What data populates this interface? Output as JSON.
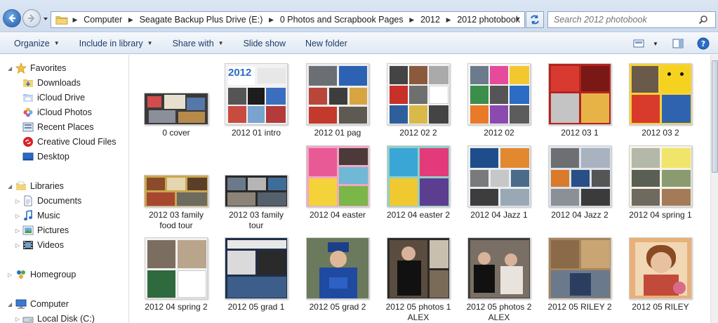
{
  "address": {
    "crumbs": [
      "Computer",
      "Seagate Backup Plus Drive (E:)",
      "0 Photos and Scrapbook Pages",
      "2012",
      "2012 photobook"
    ]
  },
  "search": {
    "placeholder": "Search 2012 photobook"
  },
  "toolbar": {
    "organize": "Organize",
    "include_in_library": "Include in library",
    "share_with": "Share with",
    "slide_show": "Slide show",
    "new_folder": "New folder"
  },
  "nav": {
    "favorites": "Favorites",
    "downloads": "Downloads",
    "icloud_drive": "iCloud Drive",
    "icloud_photos": "iCloud Photos",
    "recent_places": "Recent Places",
    "creative_cloud": "Creative Cloud Files",
    "desktop": "Desktop",
    "libraries": "Libraries",
    "documents": "Documents",
    "music": "Music",
    "pictures": "Pictures",
    "videos": "Videos",
    "homegroup": "Homegroup",
    "computer": "Computer",
    "local_disk": "Local Disk (C:)"
  },
  "files": [
    {
      "name": "0 cover",
      "line2": ""
    },
    {
      "name": "2012 01 intro",
      "line2": ""
    },
    {
      "name": "2012 01 pag",
      "line2": ""
    },
    {
      "name": "2012 02 2",
      "line2": ""
    },
    {
      "name": "2012 02",
      "line2": ""
    },
    {
      "name": "2012 03 1",
      "line2": ""
    },
    {
      "name": "2012 03 2",
      "line2": ""
    },
    {
      "name": "2012 03 family",
      "line2": "food tour"
    },
    {
      "name": "2012 03 family",
      "line2": "tour"
    },
    {
      "name": "2012 04 easter",
      "line2": ""
    },
    {
      "name": "2012 04 easter 2",
      "line2": ""
    },
    {
      "name": "2012 04 Jazz 1",
      "line2": ""
    },
    {
      "name": "2012 04 Jazz 2",
      "line2": ""
    },
    {
      "name": "2012 04 spring 1",
      "line2": ""
    },
    {
      "name": "2012 04 spring 2",
      "line2": ""
    },
    {
      "name": "2012 05 grad 1",
      "line2": ""
    },
    {
      "name": "2012 05 grad 2",
      "line2": ""
    },
    {
      "name": "2012 05 photos 1",
      "line2": "ALEX"
    },
    {
      "name": "2012 05 photos 2",
      "line2": "ALEX"
    },
    {
      "name": "2012 05 RILEY 2",
      "line2": ""
    },
    {
      "name": "2012 05 RILEY",
      "line2": ""
    }
  ],
  "colors": {
    "accent": "#1d3c66",
    "address_gradient_top": "#dbe6f4",
    "selection_blue": "#1f5dae"
  }
}
